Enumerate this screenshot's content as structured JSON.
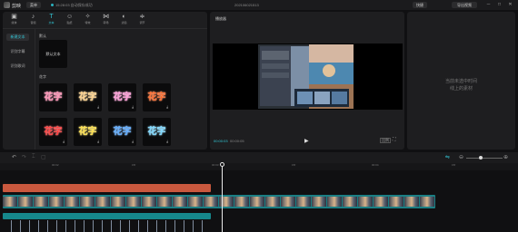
{
  "titlebar": {
    "app_name": "剪映",
    "menu_label": "菜单",
    "status_text": "15:28:03 自动保存成功",
    "project_title": "202106021513",
    "shortcut_label": "快捷",
    "export_label": "导出视频",
    "minimize_glyph": "─",
    "maximize_glyph": "□",
    "close_glyph": "✕"
  },
  "toolbar": {
    "items": [
      {
        "label": "媒体",
        "icon": "media-icon",
        "glyph": "▣"
      },
      {
        "label": "音频",
        "icon": "audio-icon",
        "glyph": "♪"
      },
      {
        "label": "文本",
        "icon": "text-icon",
        "glyph": "T"
      },
      {
        "label": "贴纸",
        "icon": "sticker-icon",
        "glyph": "☺"
      },
      {
        "label": "特效",
        "icon": "effects-icon",
        "glyph": "✧"
      },
      {
        "label": "转场",
        "icon": "transition-icon",
        "glyph": "⋈"
      },
      {
        "label": "滤镜",
        "icon": "filter-icon",
        "glyph": "◐"
      },
      {
        "label": "调节",
        "icon": "adjust-icon",
        "glyph": "≑"
      }
    ],
    "active_index": 2
  },
  "side_nav": {
    "items": [
      "新建文本",
      "识别字幕",
      "识别歌词"
    ],
    "active_index": 0
  },
  "text_library": {
    "default_section": "默认",
    "default_card_label": "默认文本",
    "flower_section": "花字",
    "flower_text": "花字",
    "download_glyph": "⤓",
    "flower_colors": [
      "#ff8fb3",
      "#ffd28a",
      "#ff9ad6",
      "#ff6a2a",
      "#ff3b3b",
      "#ffe14a",
      "#5aa9ff",
      "#7ad7ff"
    ]
  },
  "preview": {
    "header": "播放器",
    "time_current": "00:00:03",
    "time_total": "00:00:05",
    "play_glyph": "▶",
    "ratio_label": "比例",
    "fullscreen_glyph": "⛶"
  },
  "detail": {
    "line1": "当前未选中时间",
    "line2": "线上的素材"
  },
  "timeline": {
    "undo_glyph": "↶",
    "redo_glyph": "↷",
    "split_glyph": "⌶",
    "delete_glyph": "▢",
    "link_glyph": "⇋",
    "zoom_out_glyph": "⊖",
    "zoom_in_glyph": "⊕",
    "ruler_labels": [
      "00:02",
      "15f",
      "00:03",
      "15f",
      "00:04",
      "15f"
    ]
  },
  "colors": {
    "accent": "#33c7d6",
    "orange_track": "#c9583e",
    "video_track": "#1b7f84"
  }
}
